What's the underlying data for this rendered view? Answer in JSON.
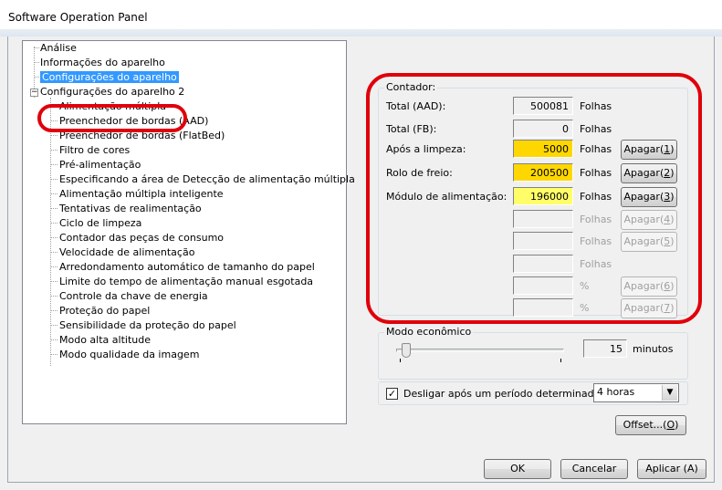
{
  "window": {
    "title": "Software Operation Panel"
  },
  "tree": {
    "items": [
      {
        "label": "Análise"
      },
      {
        "label": "Informações do aparelho"
      },
      {
        "label": "Configurações do aparelho"
      },
      {
        "label": "Configurações do aparelho 2"
      }
    ],
    "children": [
      "Alimentação múltipla",
      "Preenchedor de bordas (AAD)",
      "Preenchedor de bordas (FlatBed)",
      "Filtro de cores",
      "Pré-alimentação",
      "Especificando a área de Detecção de alimentação múltipla",
      "Alimentação múltipla inteligente",
      "Tentativas de realimentação",
      "Ciclo de limpeza",
      "Contador das peças de consumo",
      "Velocidade de alimentação",
      "Arredondamento automático de tamanho do papel",
      "Limite do tempo de alimentação manual esgotada",
      "Controle da chave de energia",
      "Proteção do papel",
      "Sensibilidade da proteção do papel",
      "Modo alta altitude",
      "Modo qualidade da imagem"
    ],
    "expander_symbol": "−"
  },
  "counter": {
    "legend": "Contador:",
    "rows": [
      {
        "label": "Total (AAD):",
        "value": "500081",
        "unit": "Folhas",
        "button": ""
      },
      {
        "label": "Total (FB):",
        "value": "0",
        "unit": "Folhas",
        "button": ""
      },
      {
        "label": "Após a limpeza:",
        "value": "5000",
        "unit": "Folhas",
        "button": "Apagar(",
        "key": "1"
      },
      {
        "label": "Rolo de freio:",
        "value": "200500",
        "unit": "Folhas",
        "button": "Apagar(",
        "key": "2"
      },
      {
        "label": "Módulo de alimentação:",
        "value": "196000",
        "unit": "Folhas",
        "button": "Apagar(",
        "key": "3"
      },
      {
        "label": "",
        "value": "",
        "unit": "Folhas",
        "button": "Apagar(",
        "key": "4"
      },
      {
        "label": "",
        "value": "",
        "unit": "Folhas",
        "button": "Apagar(",
        "key": "5"
      },
      {
        "label": "",
        "value": "",
        "unit": "Folhas",
        "button": ""
      },
      {
        "label": "",
        "value": "",
        "unit": "%",
        "button": "Apagar(",
        "key": "6"
      },
      {
        "label": "",
        "value": "",
        "unit": "%",
        "button": "Apagar(",
        "key": "7"
      }
    ],
    "button_close": ")",
    "colors": {
      "orange": "#ffd700",
      "yellow": "#fffe68"
    }
  },
  "eco": {
    "legend": "Modo econômico",
    "minutes_value": "15",
    "minutes_unit": "minutos",
    "slider_level": 0.06,
    "checkbox_label": "Desligar após um período determinado",
    "checkbox_mark": "✓",
    "checked": true,
    "power_off_select": "4 horas",
    "select_arrow": "▼"
  },
  "buttons": {
    "offset": "Offset...(",
    "offset_key": "O",
    "close": ")",
    "ok": "OK",
    "cancel": "Cancelar",
    "apply": "Aplicar (A)"
  },
  "highlight_color": "#e0000b"
}
